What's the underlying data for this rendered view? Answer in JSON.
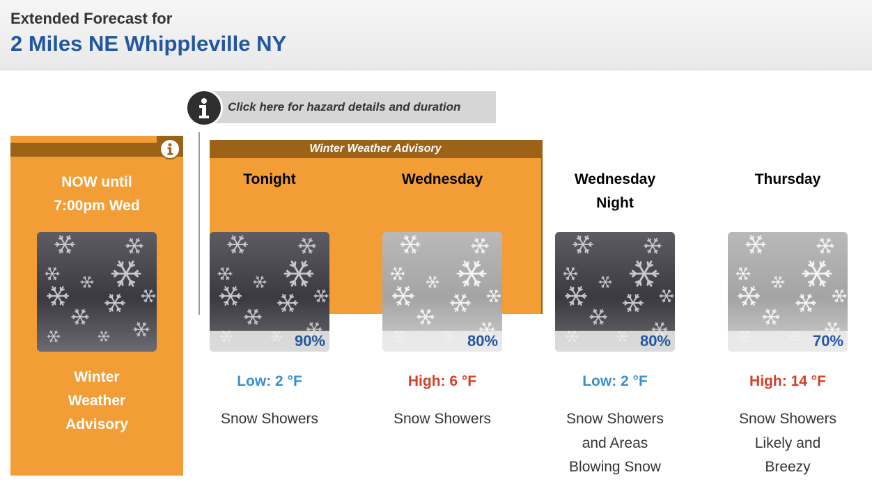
{
  "header": {
    "subtitle": "Extended Forecast for",
    "location": "2 Miles NE Whippleville NY"
  },
  "hazard_link": {
    "text": "Click here for hazard details and duration",
    "icon": "info-icon"
  },
  "advisory_banner": {
    "label": "Winter Weather Advisory",
    "color": "#f29d35",
    "strip_color": "#9c6218"
  },
  "now_card": {
    "period_line1": "NOW until",
    "period_line2": "7:00pm Wed",
    "image": "snow-showers-night-icon",
    "desc_line1": "Winter",
    "desc_line2": "Weather",
    "desc_line3": "Advisory",
    "info_icon": "info-icon"
  },
  "periods": [
    {
      "name_line1": "Tonight",
      "name_line2": "",
      "image": "snow-showers-night-icon",
      "pop": "90%",
      "temp": "Low: 2 °F",
      "temp_type": "low",
      "short_line1": "Snow Showers",
      "short_line2": "",
      "short_line3": ""
    },
    {
      "name_line1": "Wednesday",
      "name_line2": "",
      "image": "snow-showers-day-icon",
      "pop": "80%",
      "temp": "High: 6 °F",
      "temp_type": "high",
      "short_line1": "Snow Showers",
      "short_line2": "",
      "short_line3": ""
    },
    {
      "name_line1": "Wednesday",
      "name_line2": "Night",
      "image": "snow-showers-night-icon",
      "pop": "80%",
      "temp": "Low: 2 °F",
      "temp_type": "low",
      "short_line1": "Snow Showers",
      "short_line2": "and Areas",
      "short_line3": "Blowing Snow"
    },
    {
      "name_line1": "Thursday",
      "name_line2": "",
      "image": "snow-showers-day-icon",
      "pop": "70%",
      "temp": "High: 14 °F",
      "temp_type": "high",
      "short_line1": "Snow Showers",
      "short_line2": "Likely and",
      "short_line3": "Breezy"
    }
  ],
  "colors": {
    "location": "#23579f",
    "low_temp": "#3a8fd0",
    "high_temp": "#d43f27",
    "pop": "#23579f"
  }
}
